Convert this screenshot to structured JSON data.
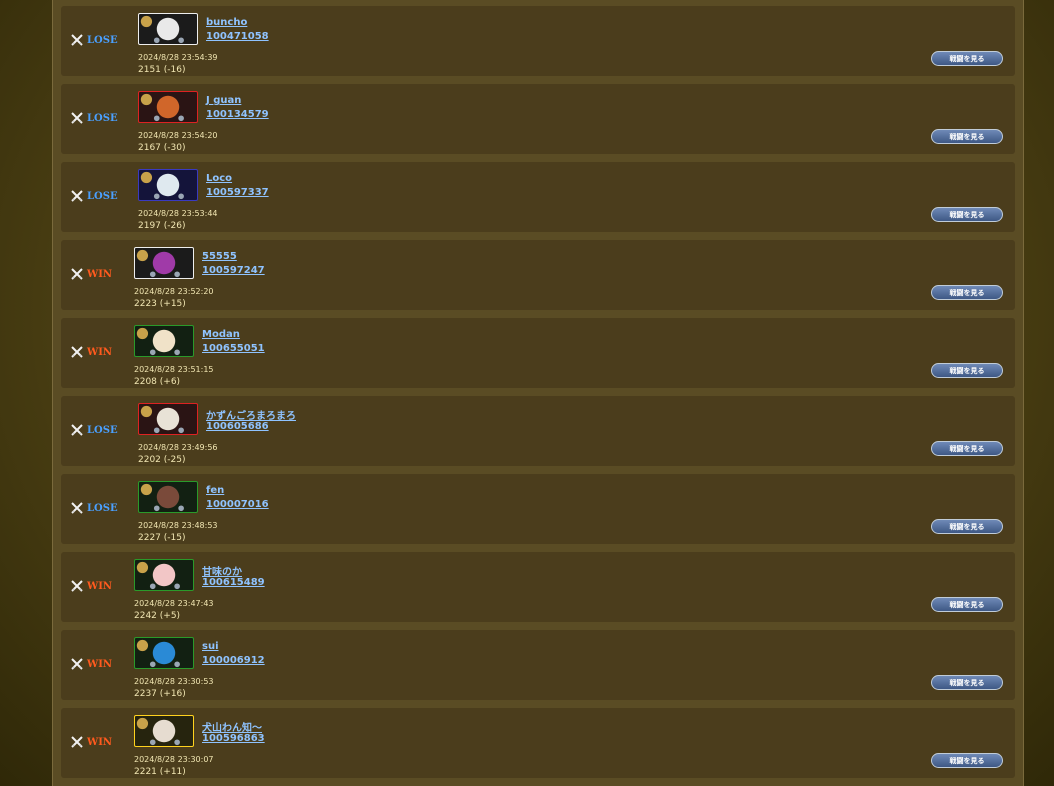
{
  "battles": [
    {
      "result": "LOSE",
      "name": "buncho",
      "player_id": "100471058",
      "datetime": "2024/8/28 23:54:39",
      "rating": "2151 (-16)",
      "button": "戦闘を見る",
      "frame": "white",
      "avatar": "#e9e9e9"
    },
    {
      "result": "LOSE",
      "name": "J guan",
      "player_id": "100134579",
      "datetime": "2024/8/28 23:54:20",
      "rating": "2167 (-30)",
      "button": "戦闘を見る",
      "frame": "red",
      "avatar": "#d0662a"
    },
    {
      "result": "LOSE",
      "name": "Loco",
      "player_id": "100597337",
      "datetime": "2024/8/28 23:53:44",
      "rating": "2197 (-26)",
      "button": "戦闘を見る",
      "frame": "blue",
      "avatar": "#dfe9ef"
    },
    {
      "result": "WIN",
      "name": "55555",
      "player_id": "100597247",
      "datetime": "2024/8/28 23:52:20",
      "rating": "2223 (+15)",
      "button": "戦闘を見る",
      "frame": "white",
      "avatar": "#a03aa8"
    },
    {
      "result": "WIN",
      "name": "Modan",
      "player_id": "100655051",
      "datetime": "2024/8/28 23:51:15",
      "rating": "2208 (+6)",
      "button": "戦闘を見る",
      "frame": "green",
      "avatar": "#f0e2c8"
    },
    {
      "result": "LOSE",
      "name": "かずんごろまろまろ",
      "player_id": "100605686",
      "datetime": "2024/8/28 23:49:56",
      "rating": "2202 (-25)",
      "button": "戦闘を見る",
      "frame": "red",
      "avatar": "#e8e2d6"
    },
    {
      "result": "LOSE",
      "name": "fen",
      "player_id": "100007016",
      "datetime": "2024/8/28 23:48:53",
      "rating": "2227 (-15)",
      "button": "戦闘を見る",
      "frame": "green",
      "avatar": "#7a4a3a"
    },
    {
      "result": "WIN",
      "name": "甘味のか",
      "player_id": "100615489",
      "datetime": "2024/8/28 23:47:43",
      "rating": "2242 (+5)",
      "button": "戦闘を見る",
      "frame": "green",
      "avatar": "#f2c6c6"
    },
    {
      "result": "WIN",
      "name": "sui",
      "player_id": "100006912",
      "datetime": "2024/8/28 23:30:53",
      "rating": "2237 (+16)",
      "button": "戦闘を見る",
      "frame": "green",
      "avatar": "#2a8ad6"
    },
    {
      "result": "WIN",
      "name": "犬山わん知～",
      "player_id": "100596863",
      "datetime": "2024/8/28 23:30:07",
      "rating": "2221 (+11)",
      "button": "戦闘を見る",
      "frame": "gold",
      "avatar": "#e6dcd0"
    }
  ]
}
